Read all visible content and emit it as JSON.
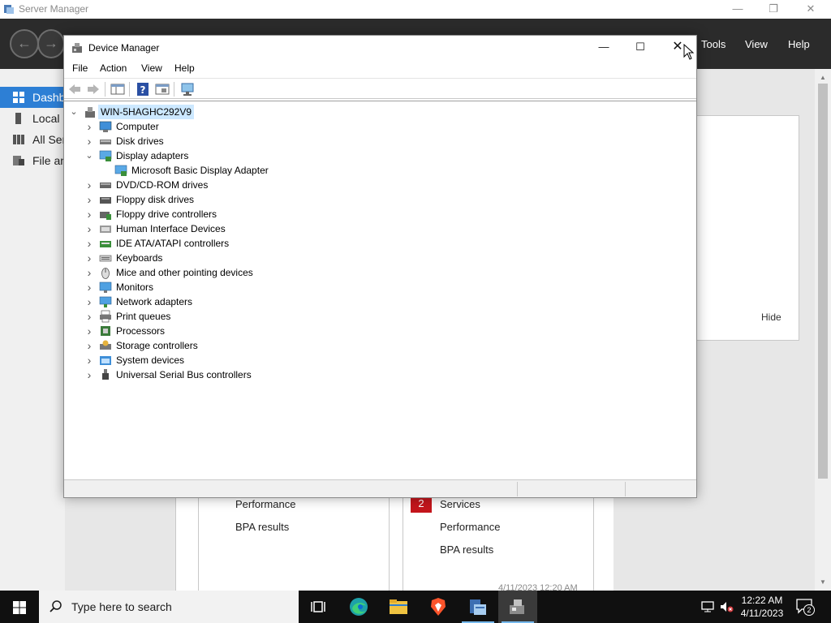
{
  "server_manager": {
    "title": "Server Manager",
    "menus": [
      "Tools",
      "View",
      "Help"
    ],
    "sidebar": [
      {
        "label": "Dashboard"
      },
      {
        "label": "Local Server"
      },
      {
        "label": "All Servers"
      },
      {
        "label": "File and Storage Services"
      }
    ],
    "welcome_hide": "Hide",
    "tile_left": {
      "items": [
        "Performance",
        "BPA results"
      ]
    },
    "tile_right": {
      "badge": "2",
      "items": [
        "Services",
        "Performance",
        "BPA results"
      ]
    },
    "timestamp": "4/11/2023 12:20 AM"
  },
  "device_manager": {
    "title": "Device Manager",
    "menus": [
      "File",
      "Action",
      "View",
      "Help"
    ],
    "root": "WIN-5HAGHC292V9",
    "categories": [
      {
        "label": "Computer",
        "icon": "computer-icon",
        "expanded": false
      },
      {
        "label": "Disk drives",
        "icon": "disk-drive-icon",
        "expanded": false
      },
      {
        "label": "Display adapters",
        "icon": "display-adapter-icon",
        "expanded": true,
        "children": [
          {
            "label": "Microsoft Basic Display Adapter",
            "icon": "display-adapter-icon"
          }
        ]
      },
      {
        "label": "DVD/CD-ROM drives",
        "icon": "dvd-icon",
        "expanded": false
      },
      {
        "label": "Floppy disk drives",
        "icon": "floppy-icon",
        "expanded": false
      },
      {
        "label": "Floppy drive controllers",
        "icon": "controller-icon",
        "expanded": false
      },
      {
        "label": "Human Interface Devices",
        "icon": "hid-icon",
        "expanded": false
      },
      {
        "label": "IDE ATA/ATAPI controllers",
        "icon": "ide-icon",
        "expanded": false
      },
      {
        "label": "Keyboards",
        "icon": "keyboard-icon",
        "expanded": false
      },
      {
        "label": "Mice and other pointing devices",
        "icon": "mouse-icon",
        "expanded": false
      },
      {
        "label": "Monitors",
        "icon": "monitor-icon",
        "expanded": false
      },
      {
        "label": "Network adapters",
        "icon": "network-icon",
        "expanded": false
      },
      {
        "label": "Print queues",
        "icon": "printer-icon",
        "expanded": false
      },
      {
        "label": "Processors",
        "icon": "processor-icon",
        "expanded": false
      },
      {
        "label": "Storage controllers",
        "icon": "storage-icon",
        "expanded": false
      },
      {
        "label": "System devices",
        "icon": "system-icon",
        "expanded": false
      },
      {
        "label": "Universal Serial Bus controllers",
        "icon": "usb-icon",
        "expanded": false
      }
    ]
  },
  "taskbar": {
    "search_placeholder": "Type here to search",
    "time": "12:22 AM",
    "date": "4/11/2023",
    "notification_count": "2",
    "apps": [
      "task-view-icon",
      "edge-icon",
      "file-explorer-icon",
      "brave-icon",
      "server-manager-icon",
      "device-manager-icon"
    ]
  },
  "colors": {
    "accent": "#2d7fd5",
    "header": "#2b2b2b",
    "badge": "#c4161c",
    "taskbar": "#101010"
  }
}
